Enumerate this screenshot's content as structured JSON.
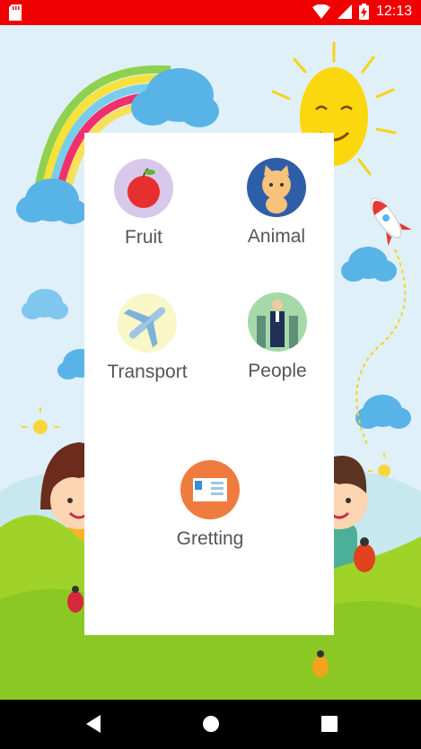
{
  "status_bar": {
    "time": "12:13"
  },
  "categories": [
    {
      "label": "Fruit",
      "icon": "apple-icon"
    },
    {
      "label": "Animal",
      "icon": "cat-icon"
    },
    {
      "label": "Transport",
      "icon": "airplane-icon"
    },
    {
      "label": "People",
      "icon": "people-icon"
    },
    {
      "label": "Gretting",
      "icon": "greeting-card-icon"
    }
  ],
  "nav_bar": {
    "icons": [
      "back-icon",
      "home-icon",
      "recents-icon"
    ]
  },
  "colors": {
    "status_bar": "#f00000",
    "label_text": "#555555",
    "sky": "#dff0f8",
    "grass": "#9fd32a"
  }
}
